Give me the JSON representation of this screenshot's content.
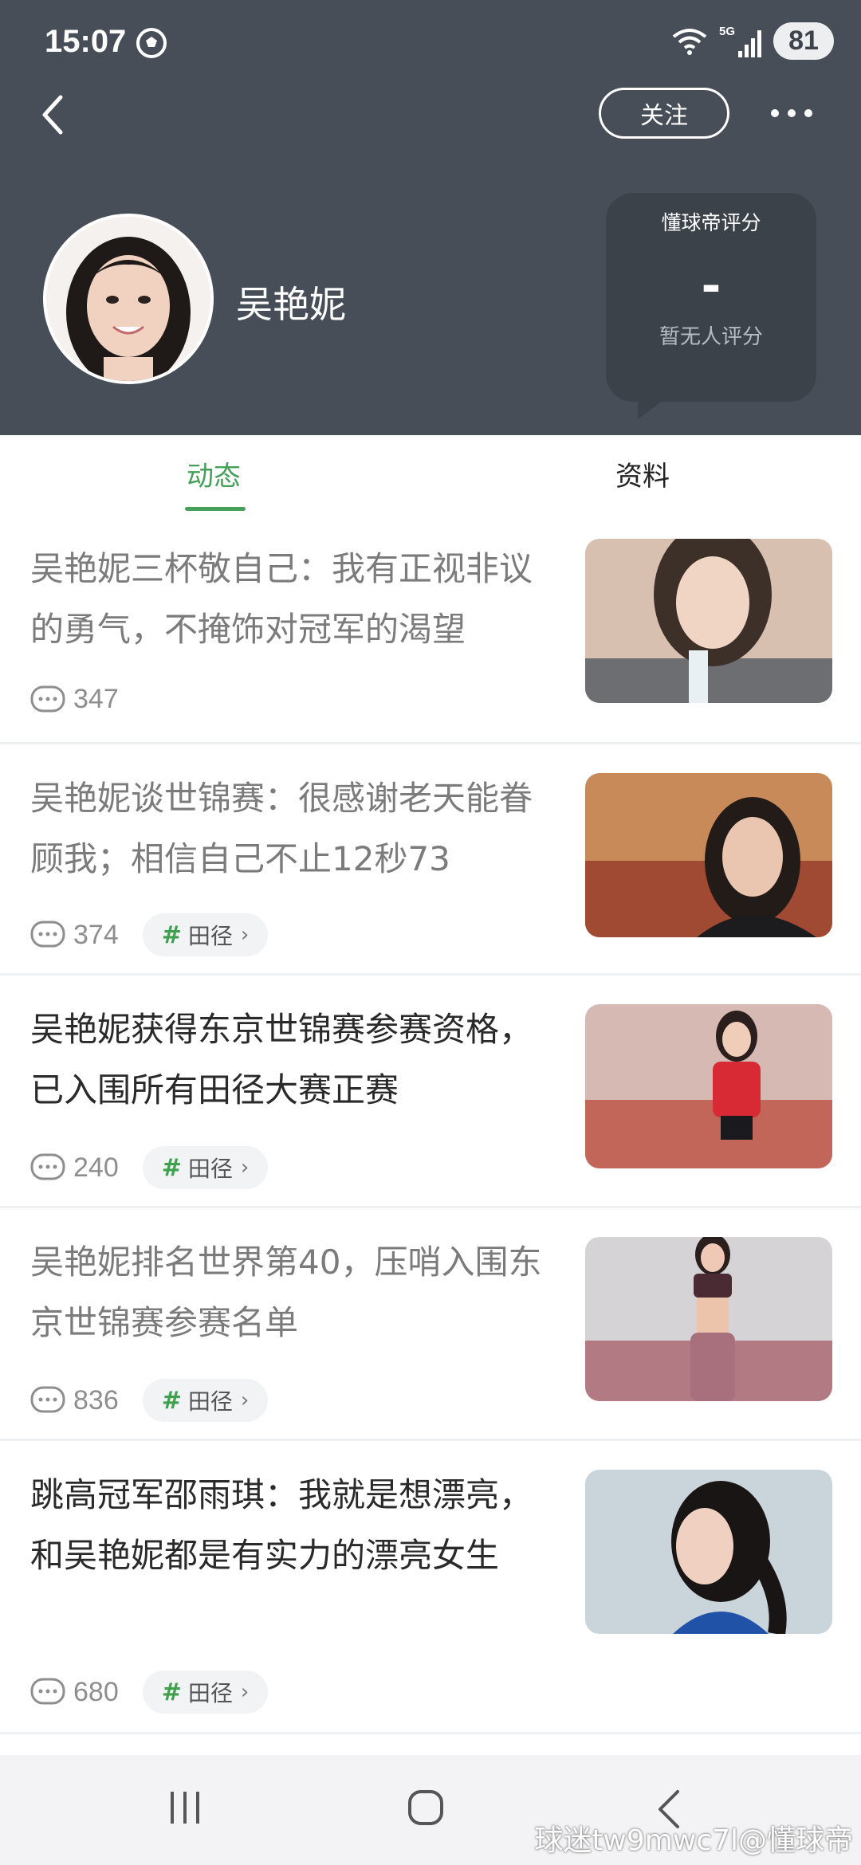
{
  "status_bar": {
    "time": "15:07",
    "network": "5G",
    "battery": "81"
  },
  "header": {
    "follow_label": "关注",
    "player_name": "吴艳妮",
    "rating": {
      "title": "懂球帝评分",
      "value": "-",
      "note": "暂无人评分"
    }
  },
  "tabs": [
    {
      "label": "动态",
      "active": true
    },
    {
      "label": "资料",
      "active": false
    }
  ],
  "feed": [
    {
      "title": "吴艳妮三杯敬自己：我有正视非议的勇气，不掩饰对冠军的渴望",
      "comments": "347",
      "tag": "",
      "read": true
    },
    {
      "title": "吴艳妮谈世锦赛：很感谢老天能眷顾我；相信自己不止12秒73",
      "comments": "374",
      "tag": "田径",
      "read": true
    },
    {
      "title": "吴艳妮获得东京世锦赛参赛资格，已入围所有田径大赛正赛",
      "comments": "240",
      "tag": "田径",
      "read": false
    },
    {
      "title": "吴艳妮排名世界第40，压哨入围东京世锦赛参赛名单",
      "comments": "836",
      "tag": "田径",
      "read": true
    },
    {
      "title": "跳高冠军邵雨琪：我就是想漂亮，和吴艳妮都是有实力的漂亮女生",
      "comments": "680",
      "tag": "田径",
      "read": false
    }
  ],
  "watermark": "球迷tw9mwc7l@懂球帝",
  "colors": {
    "header_bg": "#474e57",
    "accent_green": "#45a05a"
  },
  "icons": [
    "soccer-ball-icon",
    "wifi-icon",
    "signal-icon",
    "back-arrow-icon",
    "more-icon",
    "comment-icon",
    "recent-apps-icon",
    "home-icon",
    "nav-back-icon"
  ]
}
